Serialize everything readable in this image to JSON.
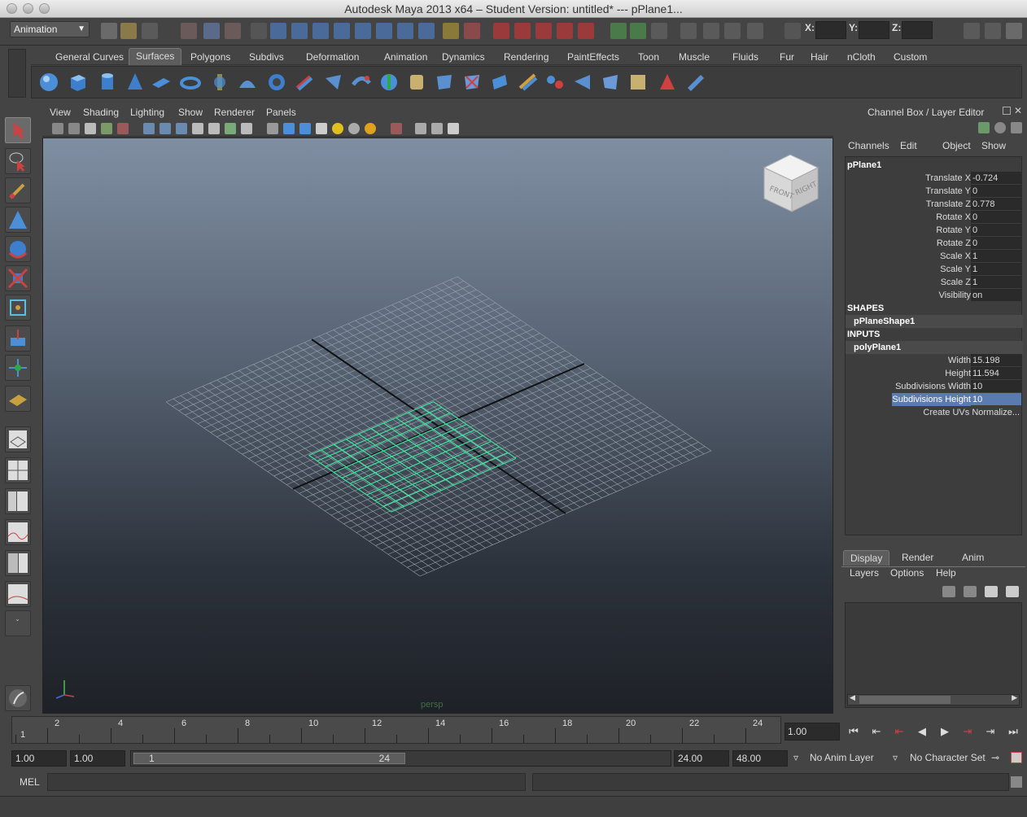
{
  "window": {
    "title": "Autodesk Maya 2013 x64 – Student Version: untitled*   ---   pPlane1..."
  },
  "status_line": {
    "mode": "Animation",
    "x_label": "X:",
    "y_label": "Y:",
    "z_label": "Z:"
  },
  "shelf_tabs": [
    {
      "label": "General"
    },
    {
      "label": "Curves"
    },
    {
      "label": "Surfaces"
    },
    {
      "label": "Polygons"
    },
    {
      "label": "Subdivs"
    },
    {
      "label": "Deformation"
    },
    {
      "label": "Animation"
    },
    {
      "label": "Dynamics"
    },
    {
      "label": "Rendering"
    },
    {
      "label": "PaintEffects"
    },
    {
      "label": "Toon"
    },
    {
      "label": "Muscle"
    },
    {
      "label": "Fluids"
    },
    {
      "label": "Fur"
    },
    {
      "label": "Hair"
    },
    {
      "label": "nCloth"
    },
    {
      "label": "Custom"
    }
  ],
  "active_shelf_tab": "Surfaces",
  "panel_menu": [
    "View",
    "Shading",
    "Lighting",
    "Show",
    "Renderer",
    "Panels"
  ],
  "viewport": {
    "camera_label": "persp",
    "viewcube_front": "FRONT",
    "viewcube_right": "RIGHT"
  },
  "channel_box": {
    "title": "Channel Box / Layer Editor",
    "menu": [
      "Channels",
      "Edit",
      "Object",
      "Show"
    ],
    "object": "pPlane1",
    "attributes": [
      {
        "label": "Translate X",
        "value": "-0.724"
      },
      {
        "label": "Translate Y",
        "value": "0"
      },
      {
        "label": "Translate Z",
        "value": "0.778"
      },
      {
        "label": "Rotate X",
        "value": "0"
      },
      {
        "label": "Rotate Y",
        "value": "0"
      },
      {
        "label": "Rotate Z",
        "value": "0"
      },
      {
        "label": "Scale X",
        "value": "1"
      },
      {
        "label": "Scale Y",
        "value": "1"
      },
      {
        "label": "Scale Z",
        "value": "1"
      },
      {
        "label": "Visibility",
        "value": "on"
      }
    ],
    "shapes_header": "SHAPES",
    "shape_name": "pPlaneShape1",
    "inputs_header": "INPUTS",
    "input_name": "polyPlane1",
    "inputs": [
      {
        "label": "Width",
        "value": "15.198"
      },
      {
        "label": "Height",
        "value": "11.594"
      },
      {
        "label": "Subdivisions Width",
        "value": "10"
      },
      {
        "label": "Subdivisions Height",
        "value": "10"
      }
    ],
    "uv_label": "Create UVs Normalize..."
  },
  "layer_editor": {
    "tabs": [
      "Display",
      "Render",
      "Anim"
    ],
    "menu": [
      "Layers",
      "Options",
      "Help"
    ]
  },
  "time_slider": {
    "labels": [
      "2",
      "4",
      "6",
      "8",
      "10",
      "12",
      "14",
      "16",
      "18",
      "20",
      "22",
      "24"
    ],
    "start_label": "1",
    "current_frame": "1.00"
  },
  "range_slider": {
    "start": "1.00",
    "playback_start": "1.00",
    "range_left": "1",
    "range_right": "24",
    "playback_end": "24.00",
    "end": "48.00",
    "anim_layer": "No Anim Layer",
    "character_set": "No Character Set"
  },
  "command_line": {
    "label": "MEL"
  },
  "colors": {
    "accent_select": "#5a7bb0",
    "grid_selected": "#3fe8a0",
    "viewport_top": "#7f8fa2"
  }
}
